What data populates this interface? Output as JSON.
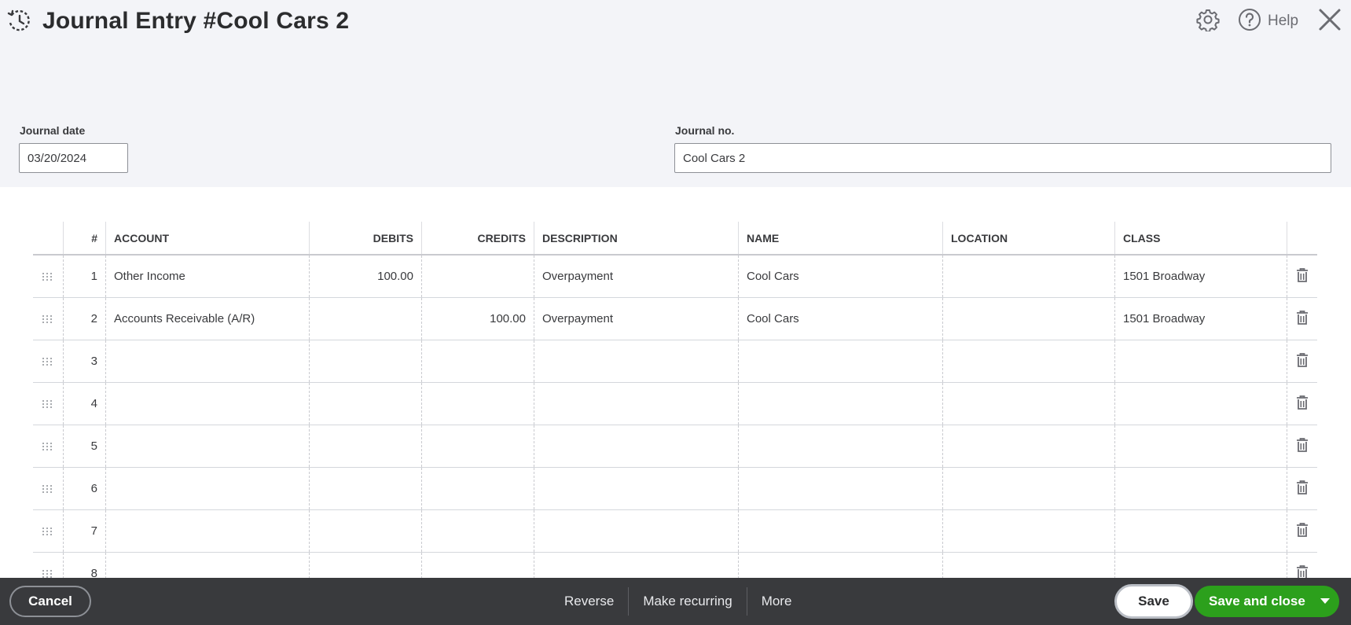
{
  "header": {
    "title": "Journal Entry #Cool Cars 2",
    "help_label": "Help"
  },
  "form": {
    "date_label": "Journal date",
    "date_value": "03/20/2024",
    "journal_no_label": "Journal no.",
    "journal_no_value": "Cool Cars 2"
  },
  "table": {
    "columns": {
      "num": "#",
      "account": "ACCOUNT",
      "debits": "DEBITS",
      "credits": "CREDITS",
      "description": "DESCRIPTION",
      "name": "NAME",
      "location": "LOCATION",
      "class": "CLASS"
    },
    "rows": [
      {
        "num": "1",
        "account": "Other Income",
        "debits": "100.00",
        "credits": "",
        "description": "Overpayment",
        "name": "Cool Cars",
        "location": "",
        "class": "1501 Broadway"
      },
      {
        "num": "2",
        "account": "Accounts Receivable (A/R)",
        "debits": "",
        "credits": "100.00",
        "description": "Overpayment",
        "name": "Cool Cars",
        "location": "",
        "class": "1501 Broadway"
      },
      {
        "num": "3",
        "account": "",
        "debits": "",
        "credits": "",
        "description": "",
        "name": "",
        "location": "",
        "class": ""
      },
      {
        "num": "4",
        "account": "",
        "debits": "",
        "credits": "",
        "description": "",
        "name": "",
        "location": "",
        "class": ""
      },
      {
        "num": "5",
        "account": "",
        "debits": "",
        "credits": "",
        "description": "",
        "name": "",
        "location": "",
        "class": ""
      },
      {
        "num": "6",
        "account": "",
        "debits": "",
        "credits": "",
        "description": "",
        "name": "",
        "location": "",
        "class": ""
      },
      {
        "num": "7",
        "account": "",
        "debits": "",
        "credits": "",
        "description": "",
        "name": "",
        "location": "",
        "class": ""
      },
      {
        "num": "8",
        "account": "",
        "debits": "",
        "credits": "",
        "description": "",
        "name": "",
        "location": "",
        "class": ""
      }
    ]
  },
  "footer": {
    "cancel_label": "Cancel",
    "reverse_label": "Reverse",
    "recurring_label": "Make recurring",
    "more_label": "More",
    "save_label": "Save",
    "save_close_label": "Save and close"
  },
  "icons": {
    "history": "history-icon",
    "settings": "gear-icon",
    "help": "help-circle-icon",
    "close": "close-icon",
    "drag": "drag-handle-icon",
    "delete": "trash-icon",
    "dropdown": "caret-down-icon"
  },
  "colors": {
    "header_bg": "#f3f4f8",
    "footer_bg": "#393a3d",
    "primary_green": "#2ca01c",
    "text": "#393a3d"
  }
}
